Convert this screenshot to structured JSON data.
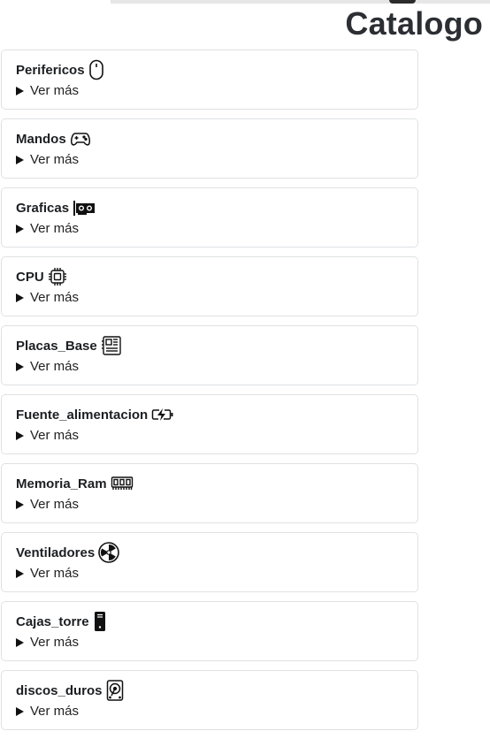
{
  "page": {
    "title": "Catalogo"
  },
  "catalog": {
    "items": [
      {
        "title": "Perifericos",
        "toggle_label": "Ver más",
        "icon": "mouse-icon"
      },
      {
        "title": "Mandos",
        "toggle_label": "Ver más",
        "icon": "gamepad-icon"
      },
      {
        "title": "Graficas",
        "toggle_label": "Ver más",
        "icon": "gpu-card-icon"
      },
      {
        "title": "CPU",
        "toggle_label": "Ver más",
        "icon": "cpu-icon"
      },
      {
        "title": "Placas_Base",
        "toggle_label": "Ver más",
        "icon": "motherboard-icon"
      },
      {
        "title": "Fuente_alimentacion",
        "toggle_label": "Ver más",
        "icon": "battery-charging-icon"
      },
      {
        "title": "Memoria_Ram",
        "toggle_label": "Ver más",
        "icon": "memory-icon"
      },
      {
        "title": "Ventiladores",
        "toggle_label": "Ver más",
        "icon": "fan-icon"
      },
      {
        "title": "Cajas_torre",
        "toggle_label": "Ver más",
        "icon": "pc-tower-icon"
      },
      {
        "title": "discos_duros",
        "toggle_label": "Ver más",
        "icon": "hard-drive-icon"
      }
    ]
  }
}
